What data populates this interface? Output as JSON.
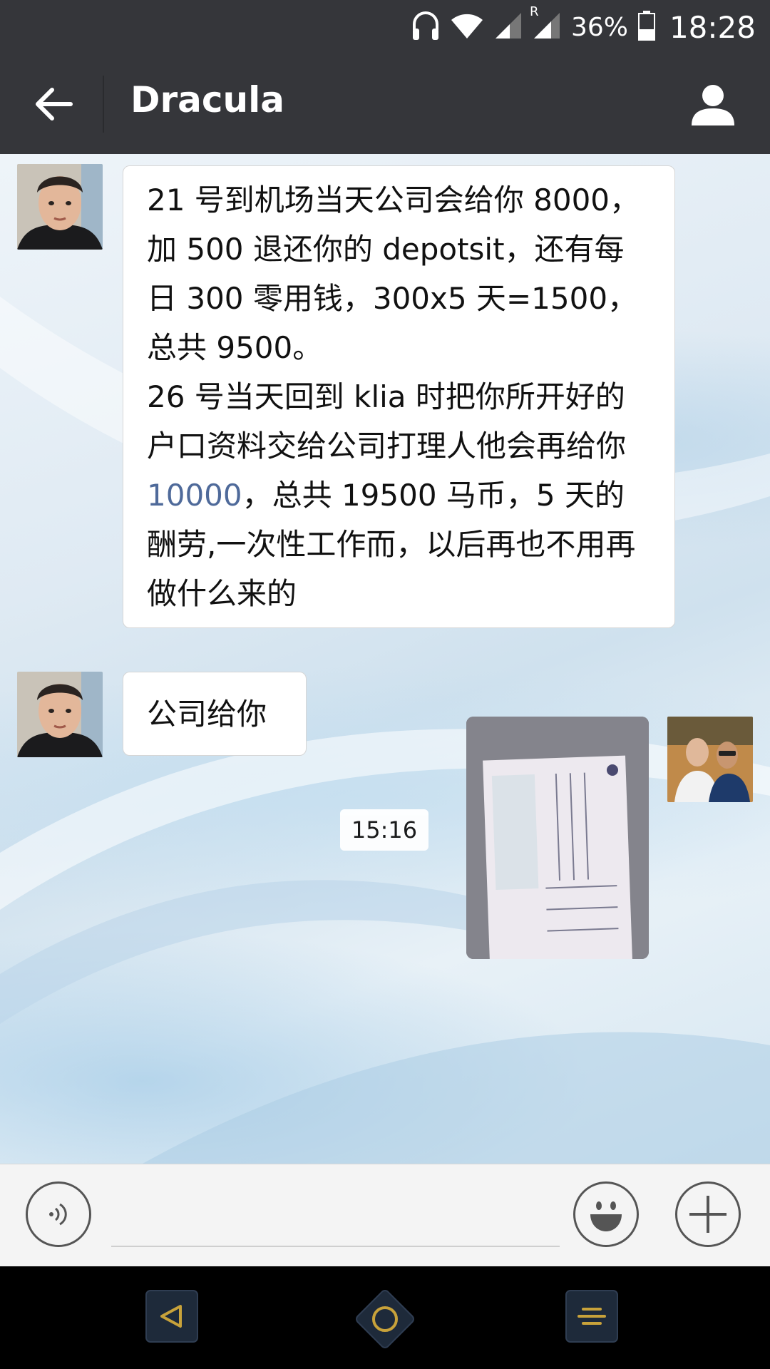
{
  "status_bar": {
    "battery_percent": "36%",
    "time": "18:28",
    "icons": [
      "headset-icon",
      "wifi-icon",
      "signal-icon",
      "roaming-signal-icon",
      "battery-icon"
    ],
    "roaming_label": "R"
  },
  "header": {
    "title": "Dracula",
    "back_icon": "back-arrow-icon",
    "profile_icon": "person-icon"
  },
  "messages": [
    {
      "side": "left",
      "paragraphs": [
        "21 号到机场当天公司会给你 8000，加 500 退还你的 depotsit，还有每日 300 零用钱，300x5 天=1500，总共 9500。"
      ],
      "para2_before": "26 号当天回到 klia 时把你所开好的户口资料交给公司打理人他会再给你 ",
      "para2_link": "10000",
      "para2_after": "，总共 19500 马币，5 天的酬劳,一次性工作而，以后再也不用再做什么来的"
    },
    {
      "side": "left",
      "text": "公司给你"
    }
  ],
  "timestamp": "15:16",
  "input_bar": {
    "voice_icon": "voice-icon",
    "emoji_icon": "smiley-icon",
    "plus_icon": "plus-icon",
    "input_value": ""
  },
  "nav_bar": {
    "icons": [
      "back-triangle-icon",
      "home-circle-icon",
      "menu-icon"
    ]
  },
  "colors": {
    "header_bg": "#35363a",
    "link": "#4f6a9a",
    "nav_accent": "#c8a23a"
  }
}
